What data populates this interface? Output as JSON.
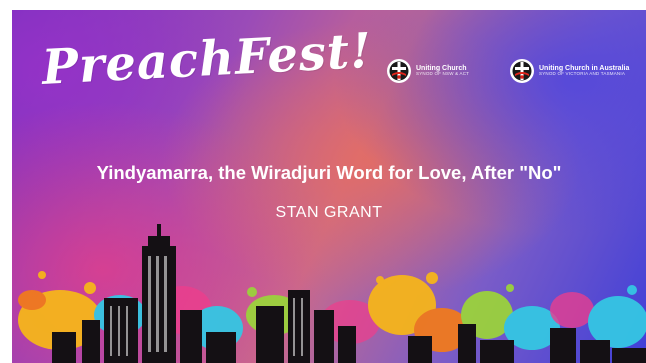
{
  "logo": {
    "text": "PreachFest!"
  },
  "organizations": [
    {
      "name": "Uniting Church",
      "subtitle": "SYNOD OF NSW & ACT",
      "icon": "uniting-church-cross-icon"
    },
    {
      "name": "Uniting Church in Australia",
      "subtitle": "SYNOD OF VICTORIA AND TASMANIA",
      "icon": "uniting-church-cross-icon"
    }
  ],
  "talk": {
    "title": "Yindyamarra, the Wiradjuri Word for Love, After \"No\"",
    "speaker": "STAN GRANT"
  },
  "colors": {
    "background_left": "#7a2fc0",
    "background_center": "#c86a8c",
    "background_right": "#3f3fd8",
    "text": "#ffffff",
    "skyline": "#141014",
    "paint_yellow": "#f6b51b",
    "paint_orange": "#f07a1e",
    "paint_green": "#9bd23c",
    "paint_cyan": "#35c6e3",
    "paint_pink": "#ef3d8c"
  }
}
